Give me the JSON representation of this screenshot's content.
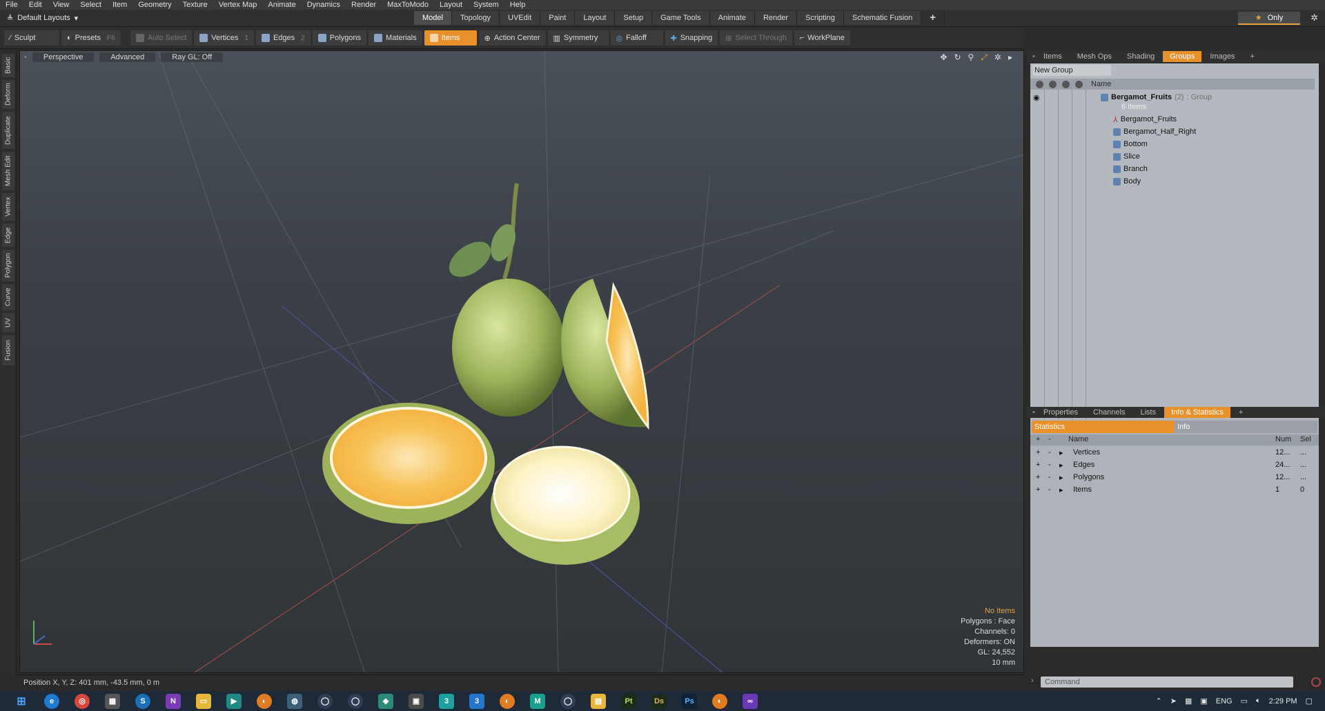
{
  "menu": [
    "File",
    "Edit",
    "View",
    "Select",
    "Item",
    "Geometry",
    "Texture",
    "Vertex Map",
    "Animate",
    "Dynamics",
    "Render",
    "MaxToModo",
    "Layout",
    "System",
    "Help"
  ],
  "layout": {
    "selector": "Default Layouts",
    "tabs": [
      "Model",
      "Topology",
      "UVEdit",
      "Paint",
      "Layout",
      "Setup",
      "Game Tools",
      "Animate",
      "Render",
      "Scripting",
      "Schematic Fusion"
    ],
    "active_tab": "Model",
    "plus": "+",
    "only_label": "Only"
  },
  "toolbar": {
    "sculpt": "Sculpt",
    "presets": "Presets",
    "presets_key": "F6",
    "auto_select": "Auto Select",
    "vertices": "Vertices",
    "vertices_key": "1",
    "edges": "Edges",
    "edges_key": "2",
    "polygons": "Polygons",
    "materials": "Materials",
    "items": "Items",
    "action_center": "Action Center",
    "symmetry": "Symmetry",
    "falloff": "Falloff",
    "snapping": "Snapping",
    "select_through": "Select Through",
    "workplane": "WorkPlane"
  },
  "left_tabs": [
    "Basic",
    "Deform",
    "Duplicate",
    "Mesh Edit",
    "Vertex",
    "Edge",
    "Polygon",
    "Curve",
    "UV",
    "Fusion"
  ],
  "viewport": {
    "perspective": "Perspective",
    "advanced": "Advanced",
    "raygl": "Ray GL: Off",
    "stats": {
      "no_items": "No Items",
      "polygons": "Polygons : Face",
      "channels": "Channels: 0",
      "deformers": "Deformers: ON",
      "gl": "GL: 24,552",
      "scale": "10 mm"
    }
  },
  "status": "Position X, Y, Z:  401 mm, -43.5 mm, 0 m",
  "groups_panel": {
    "tabs": [
      "Items",
      "Mesh Ops",
      "Shading",
      "Groups",
      "Images"
    ],
    "active_tab": "Groups",
    "new_group": "New Group",
    "name_header": "Name",
    "group_name": "Bergamot_Fruits",
    "group_count": "(2)",
    "group_type": ": Group",
    "group_items": "6 Items",
    "children": [
      "Bergamot_Fruits",
      "Bergamot_Half_Right",
      "Bottom",
      "Slice",
      "Branch",
      "Body"
    ]
  },
  "info_panel": {
    "tabs": [
      "Properties",
      "Channels",
      "Lists",
      "Info & Statistics"
    ],
    "active_tab": "Info & Statistics",
    "sub_tabs": [
      "Statistics",
      "Info"
    ],
    "headers": {
      "name": "Name",
      "num": "Num",
      "sel": "Sel"
    },
    "rows": [
      {
        "name": "Vertices",
        "num": "12...",
        "sel": "..."
      },
      {
        "name": "Edges",
        "num": "24...",
        "sel": "..."
      },
      {
        "name": "Polygons",
        "num": "12...",
        "sel": "..."
      },
      {
        "name": "Items",
        "num": "1",
        "sel": "0"
      }
    ]
  },
  "command": {
    "placeholder": "Command"
  },
  "tray": {
    "lang": "ENG",
    "time": "2:29 PM"
  },
  "colors": {
    "accent": "#e8912a",
    "viewport_top": "#4a5158",
    "viewport_bottom": "#2f3438"
  }
}
